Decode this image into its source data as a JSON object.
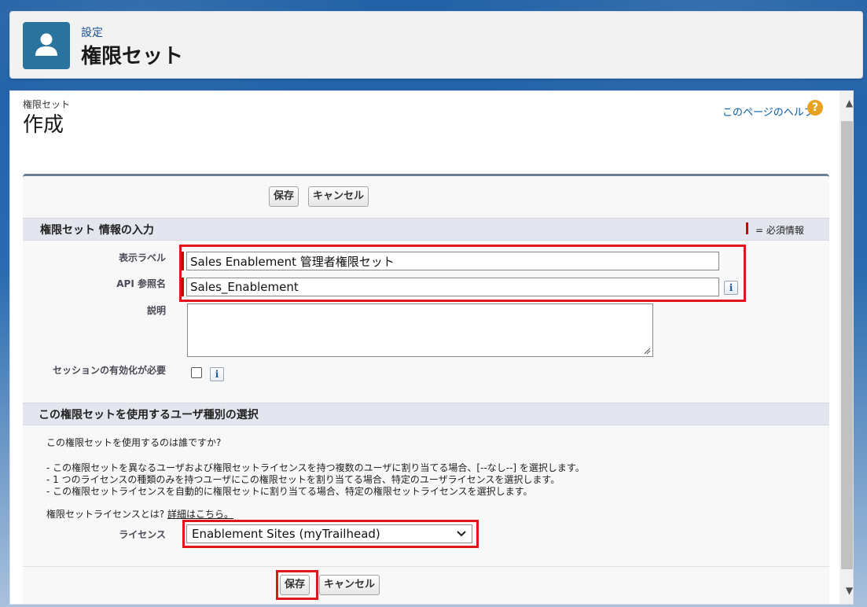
{
  "header": {
    "breadcrumb": "設定",
    "title": "権限セット",
    "icon": "user-icon"
  },
  "page": {
    "type_label": "権限セット",
    "title": "作成",
    "help_link": "このページのヘルプ",
    "help_icon": "?"
  },
  "buttons": {
    "save": "保存",
    "cancel": "キャンセル"
  },
  "section1": {
    "title": "権限セット 情報の入力",
    "required_legend": "= 必須情報",
    "fields": {
      "label": {
        "label": "表示ラベル",
        "value": "Sales Enablement 管理者権限セット"
      },
      "api_name": {
        "label": "API 参照名",
        "value": "Sales_Enablement"
      },
      "description": {
        "label": "説明",
        "value": ""
      },
      "session": {
        "label": "セッションの有効化が必要",
        "checked": false
      }
    },
    "info_glyph": "i"
  },
  "section2": {
    "title": "この権限セットを使用するユーザ種別の選択",
    "question": "この権限セットを使用するのは誰ですか?",
    "bullets": [
      "- この権限セットを異なるユーザおよび権限セットライセンスを持つ複数のユーザに割り当てる場合、[--なし--] を選択します。",
      "- 1 つのライセンスの種類のみを持つユーザにこの権限セットを割り当てる場合、特定のユーザライセンスを選択します。",
      "- この権限セットライセンスを自動的に権限セットに割り当てる場合、特定の権限セットライセンスを選択します。"
    ],
    "license_question": "権限セットライセンスとは?",
    "details_link": "詳細はこちら。",
    "license_label": "ライセンス",
    "license_value": "Enablement Sites (myTrailhead)"
  },
  "colors": {
    "accent_blue": "#2a739e",
    "required_red": "#cc0000",
    "highlight_red": "#e0161c"
  }
}
